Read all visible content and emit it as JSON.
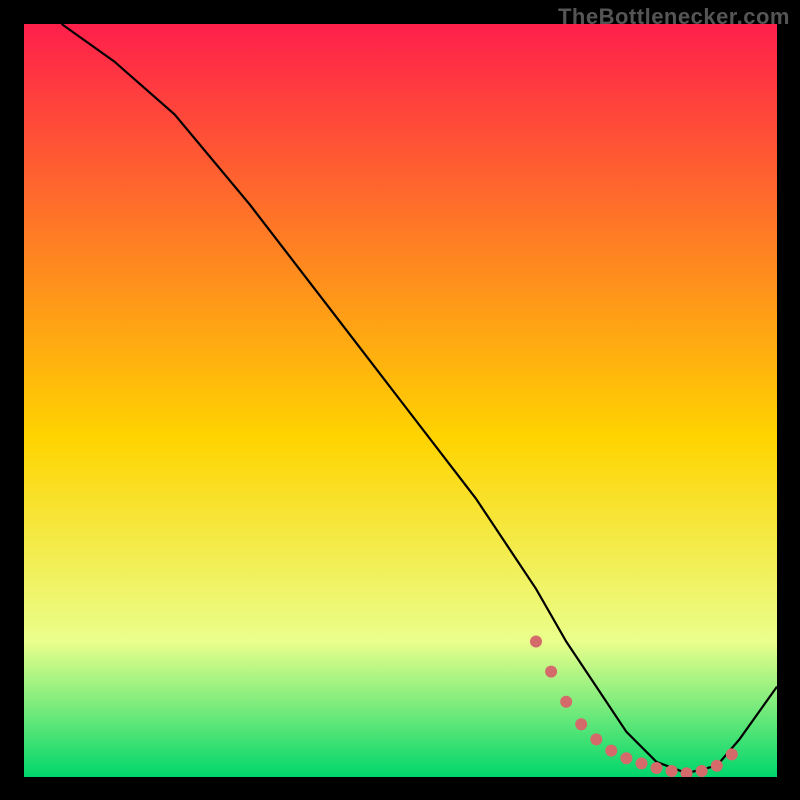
{
  "watermark": "TheBottlenecker.com",
  "colors": {
    "bg": "#000000",
    "grad_top": "#ff1f4b",
    "grad_mid": "#ffd400",
    "grad_low": "#eaff8c",
    "grad_bottom": "#00d66b",
    "line": "#000000",
    "dot": "#d46a6a"
  },
  "chart_data": {
    "type": "line",
    "title": "",
    "xlabel": "",
    "ylabel": "",
    "xlim": [
      0,
      100
    ],
    "ylim": [
      0,
      100
    ],
    "series": [
      {
        "name": "curve",
        "x": [
          5,
          12,
          20,
          30,
          40,
          50,
          60,
          68,
          72,
          76,
          80,
          84,
          88,
          92,
          95,
          100
        ],
        "y": [
          100,
          95,
          88,
          76,
          63,
          50,
          37,
          25,
          18,
          12,
          6,
          2,
          0.5,
          1.5,
          5,
          12
        ]
      }
    ],
    "dots": {
      "name": "markers",
      "x": [
        68,
        70,
        72,
        74,
        76,
        78,
        80,
        82,
        84,
        86,
        88,
        90,
        92,
        94
      ],
      "y": [
        18,
        14,
        10,
        7,
        5,
        3.5,
        2.5,
        1.8,
        1.2,
        0.8,
        0.5,
        0.8,
        1.5,
        3
      ]
    }
  }
}
